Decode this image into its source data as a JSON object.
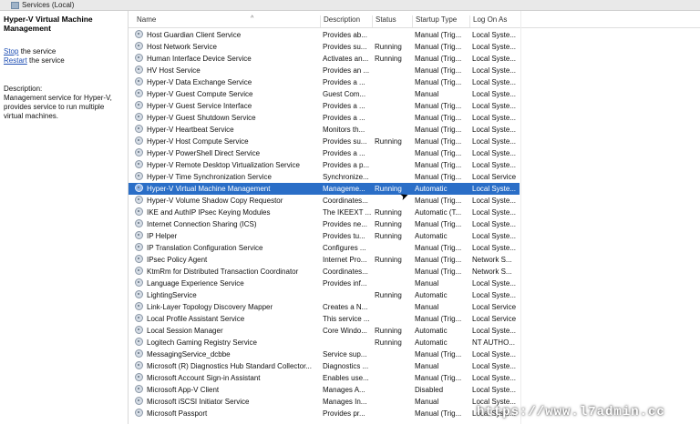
{
  "window": {
    "title": "Services (Local)"
  },
  "left_pane": {
    "service_title": "Hyper-V Virtual Machine Management",
    "stop_link": "Stop",
    "stop_suffix": " the service",
    "restart_link": "Restart",
    "restart_suffix": " the service",
    "description_label": "Description:",
    "description_text": "Management service for Hyper-V, provides service to run multiple virtual machines."
  },
  "columns": {
    "name": "Name",
    "description": "Description",
    "status": "Status",
    "startup_type": "Startup Type",
    "log_on_as": "Log On As"
  },
  "services": [
    {
      "name": "Host Guardian Client Service",
      "description": "Provides ab...",
      "status": "",
      "startup": "Manual (Trig...",
      "logon": "Local Syste..."
    },
    {
      "name": "Host Network Service",
      "description": "Provides su...",
      "status": "Running",
      "startup": "Manual (Trig...",
      "logon": "Local Syste..."
    },
    {
      "name": "Human Interface Device Service",
      "description": "Activates an...",
      "status": "Running",
      "startup": "Manual (Trig...",
      "logon": "Local Syste..."
    },
    {
      "name": "HV Host Service",
      "description": "Provides an ...",
      "status": "",
      "startup": "Manual (Trig...",
      "logon": "Local Syste..."
    },
    {
      "name": "Hyper-V Data Exchange Service",
      "description": "Provides a ...",
      "status": "",
      "startup": "Manual (Trig...",
      "logon": "Local Syste..."
    },
    {
      "name": "Hyper-V Guest Compute Service",
      "description": "Guest Com...",
      "status": "",
      "startup": "Manual",
      "logon": "Local Syste..."
    },
    {
      "name": "Hyper-V Guest Service Interface",
      "description": "Provides a ...",
      "status": "",
      "startup": "Manual (Trig...",
      "logon": "Local Syste..."
    },
    {
      "name": "Hyper-V Guest Shutdown Service",
      "description": "Provides a ...",
      "status": "",
      "startup": "Manual (Trig...",
      "logon": "Local Syste..."
    },
    {
      "name": "Hyper-V Heartbeat Service",
      "description": "Monitors th...",
      "status": "",
      "startup": "Manual (Trig...",
      "logon": "Local Syste..."
    },
    {
      "name": "Hyper-V Host Compute Service",
      "description": "Provides su...",
      "status": "Running",
      "startup": "Manual (Trig...",
      "logon": "Local Syste..."
    },
    {
      "name": "Hyper-V PowerShell Direct Service",
      "description": "Provides a ...",
      "status": "",
      "startup": "Manual (Trig...",
      "logon": "Local Syste..."
    },
    {
      "name": "Hyper-V Remote Desktop Virtualization Service",
      "description": "Provides a p...",
      "status": "",
      "startup": "Manual (Trig...",
      "logon": "Local Syste..."
    },
    {
      "name": "Hyper-V Time Synchronization Service",
      "description": "Synchronize...",
      "status": "",
      "startup": "Manual (Trig...",
      "logon": "Local Service"
    },
    {
      "name": "Hyper-V Virtual Machine Management",
      "description": "Manageme...",
      "status": "Running",
      "startup": "Automatic",
      "logon": "Local Syste...",
      "selected": true
    },
    {
      "name": "Hyper-V Volume Shadow Copy Requestor",
      "description": "Coordinates...",
      "status": "",
      "startup": "Manual (Trig...",
      "logon": "Local Syste..."
    },
    {
      "name": "IKE and AuthIP IPsec Keying Modules",
      "description": "The IKEEXT ...",
      "status": "Running",
      "startup": "Automatic (T...",
      "logon": "Local Syste..."
    },
    {
      "name": "Internet Connection Sharing (ICS)",
      "description": "Provides ne...",
      "status": "Running",
      "startup": "Manual (Trig...",
      "logon": "Local Syste..."
    },
    {
      "name": "IP Helper",
      "description": "Provides tu...",
      "status": "Running",
      "startup": "Automatic",
      "logon": "Local Syste..."
    },
    {
      "name": "IP Translation Configuration Service",
      "description": "Configures ...",
      "status": "",
      "startup": "Manual (Trig...",
      "logon": "Local Syste..."
    },
    {
      "name": "IPsec Policy Agent",
      "description": "Internet Pro...",
      "status": "Running",
      "startup": "Manual (Trig...",
      "logon": "Network S..."
    },
    {
      "name": "KtmRm for Distributed Transaction Coordinator",
      "description": "Coordinates...",
      "status": "",
      "startup": "Manual (Trig...",
      "logon": "Network S..."
    },
    {
      "name": "Language Experience Service",
      "description": "Provides inf...",
      "status": "",
      "startup": "Manual",
      "logon": "Local Syste..."
    },
    {
      "name": "LightingService",
      "description": "",
      "status": "Running",
      "startup": "Automatic",
      "logon": "Local Syste..."
    },
    {
      "name": "Link-Layer Topology Discovery Mapper",
      "description": "Creates a N...",
      "status": "",
      "startup": "Manual",
      "logon": "Local Service"
    },
    {
      "name": "Local Profile Assistant Service",
      "description": "This service ...",
      "status": "",
      "startup": "Manual (Trig...",
      "logon": "Local Service"
    },
    {
      "name": "Local Session Manager",
      "description": "Core Windo...",
      "status": "Running",
      "startup": "Automatic",
      "logon": "Local Syste..."
    },
    {
      "name": "Logitech Gaming Registry Service",
      "description": "",
      "status": "Running",
      "startup": "Automatic",
      "logon": "NT AUTHO..."
    },
    {
      "name": "MessagingService_dcbbe",
      "description": "Service sup...",
      "status": "",
      "startup": "Manual (Trig...",
      "logon": "Local Syste..."
    },
    {
      "name": "Microsoft (R) Diagnostics Hub Standard Collector...",
      "description": "Diagnostics ...",
      "status": "",
      "startup": "Manual",
      "logon": "Local Syste..."
    },
    {
      "name": "Microsoft Account Sign-in Assistant",
      "description": "Enables use...",
      "status": "",
      "startup": "Manual (Trig...",
      "logon": "Local Syste..."
    },
    {
      "name": "Microsoft App-V Client",
      "description": "Manages A...",
      "status": "",
      "startup": "Disabled",
      "logon": "Local Syste..."
    },
    {
      "name": "Microsoft iSCSI Initiator Service",
      "description": "Manages In...",
      "status": "",
      "startup": "Manual",
      "logon": "Local Syste..."
    },
    {
      "name": "Microsoft Passport",
      "description": "Provides pr...",
      "status": "",
      "startup": "Manual (Trig...",
      "logon": "Local Syste..."
    }
  ],
  "watermark": "https://www.l7admin.cc",
  "colors": {
    "selection": "#2a6ec7",
    "link": "#1f4fb4"
  }
}
